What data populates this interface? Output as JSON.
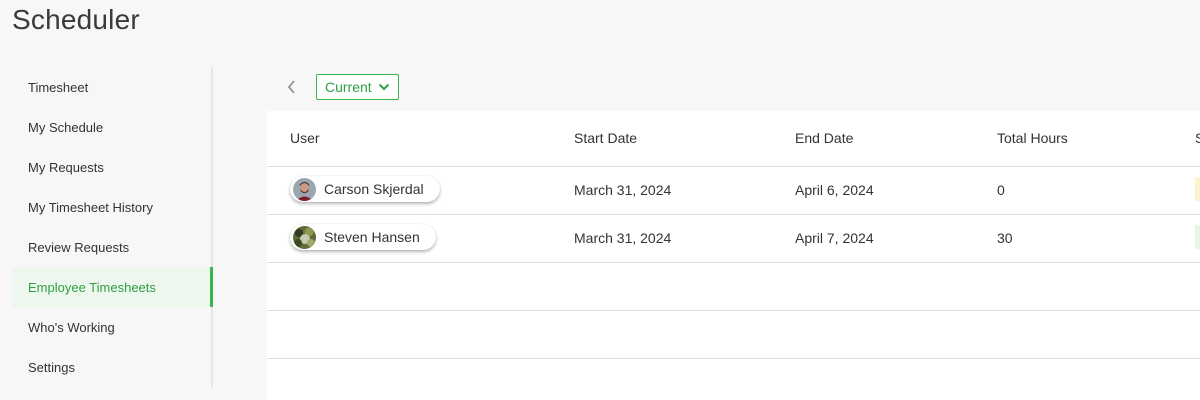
{
  "app": {
    "title": "Scheduler"
  },
  "sidebar": {
    "items": [
      {
        "label": "Timesheet"
      },
      {
        "label": "My Schedule"
      },
      {
        "label": "My Requests"
      },
      {
        "label": "My Timesheet History"
      },
      {
        "label": "Review Requests"
      },
      {
        "label": "Employee Timesheets",
        "active": true
      },
      {
        "label": "Who's Working"
      },
      {
        "label": "Settings"
      }
    ]
  },
  "toolbar": {
    "back_icon": "chevron-left-icon",
    "period_select": {
      "value": "Current",
      "icon": "chevron-down-icon"
    }
  },
  "table": {
    "columns": [
      "User",
      "Start Date",
      "End Date",
      "Total Hours",
      "S"
    ],
    "rows": [
      {
        "user": "Carson Skjerdal",
        "start": "March 31, 2024",
        "end": "April 6, 2024",
        "hours": "0",
        "status_color": "#fdf3cf"
      },
      {
        "user": "Steven Hansen",
        "start": "March 31, 2024",
        "end": "April 7, 2024",
        "hours": "30",
        "status_color": "#e7f4e7"
      }
    ]
  },
  "colors": {
    "accent": "#3bb54a",
    "accent_text": "#2e9f45",
    "active_bg": "#eef7ee"
  }
}
